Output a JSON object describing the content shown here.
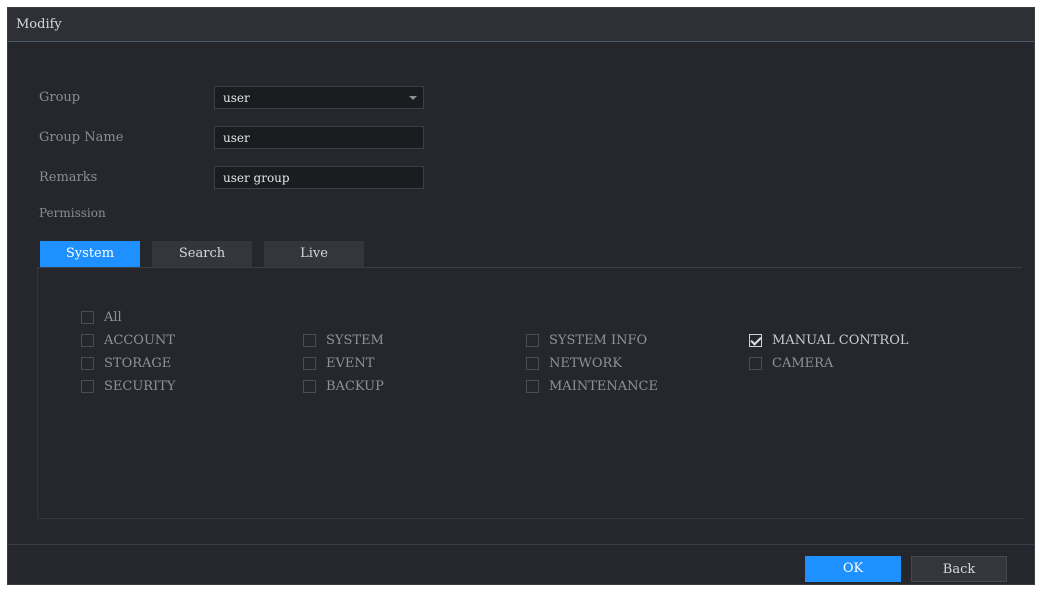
{
  "dialog": {
    "title": "Modify"
  },
  "form": {
    "group_label": "Group",
    "group_value": "user",
    "group_name_label": "Group Name",
    "group_name_value": "user",
    "remarks_label": "Remarks",
    "remarks_value": "user group",
    "permission_label": "Permission"
  },
  "tabs": [
    {
      "label": "System",
      "active": true
    },
    {
      "label": "Search",
      "active": false
    },
    {
      "label": "Live",
      "active": false
    }
  ],
  "permissions": {
    "all": {
      "label": "All",
      "checked": false
    },
    "items": [
      {
        "label": "ACCOUNT",
        "checked": false
      },
      {
        "label": "SYSTEM",
        "checked": false
      },
      {
        "label": "SYSTEM INFO",
        "checked": false
      },
      {
        "label": "MANUAL CONTROL",
        "checked": true
      },
      {
        "label": "STORAGE",
        "checked": false
      },
      {
        "label": "EVENT",
        "checked": false
      },
      {
        "label": "NETWORK",
        "checked": false
      },
      {
        "label": "CAMERA",
        "checked": false
      },
      {
        "label": "SECURITY",
        "checked": false
      },
      {
        "label": "BACKUP",
        "checked": false
      },
      {
        "label": "MAINTENANCE",
        "checked": false
      }
    ]
  },
  "buttons": {
    "ok_label": "OK",
    "back_label": "Back"
  },
  "colors": {
    "accent": "#1e90ff",
    "background": "#25272c"
  }
}
